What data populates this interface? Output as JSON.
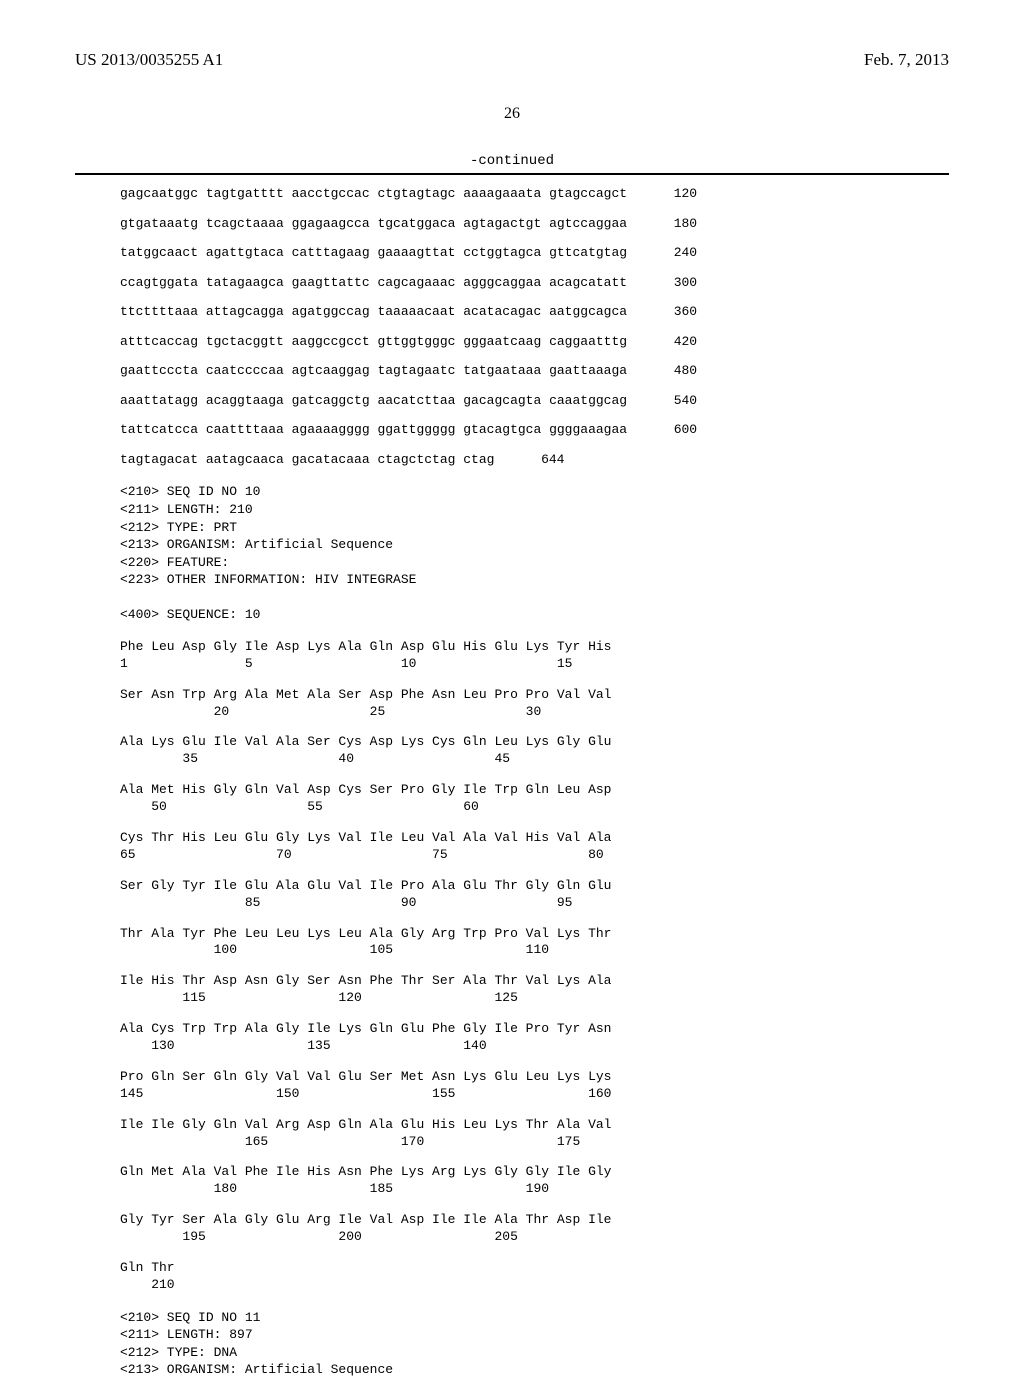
{
  "header": {
    "pub_number": "US 2013/0035255 A1",
    "pub_date": "Feb. 7, 2013"
  },
  "page_number": "26",
  "continued_label": "-continued",
  "dna_lines": [
    {
      "seq": "gagcaatggc tagtgatttt aacctgccac ctgtagtagc aaaagaaata gtagccagct",
      "num": "120"
    },
    {
      "seq": "gtgataaatg tcagctaaaa ggagaagcca tgcatggaca agtagactgt agtccaggaa",
      "num": "180"
    },
    {
      "seq": "tatggcaact agattgtaca catttagaag gaaaagttat cctggtagca gttcatgtag",
      "num": "240"
    },
    {
      "seq": "ccagtggata tatagaagca gaagttattc cagcagaaac agggcaggaa acagcatatt",
      "num": "300"
    },
    {
      "seq": "ttcttttaaa attagcagga agatggccag taaaaacaat acatacagac aatggcagca",
      "num": "360"
    },
    {
      "seq": "atttcaccag tgctacggtt aaggccgcct gttggtgggc gggaatcaag caggaatttg",
      "num": "420"
    },
    {
      "seq": "gaattcccta caatccccaa agtcaaggag tagtagaatc tatgaataaa gaattaaaga",
      "num": "480"
    },
    {
      "seq": "aaattatagg acaggtaaga gatcaggctg aacatcttaa gacagcagta caaatggcag",
      "num": "540"
    },
    {
      "seq": "tattcatcca caattttaaa agaaaagggg ggattggggg gtacagtgca ggggaaagaa",
      "num": "600"
    },
    {
      "seq": "tagtagacat aatagcaaca gacatacaaa ctagctctag ctag",
      "num": "644"
    }
  ],
  "seq10_meta": [
    "<210> SEQ ID NO 10",
    "<211> LENGTH: 210",
    "<212> TYPE: PRT",
    "<213> ORGANISM: Artificial Sequence",
    "<220> FEATURE:",
    "<223> OTHER INFORMATION: HIV INTEGRASE",
    "",
    "<400> SEQUENCE: 10"
  ],
  "protein_rows": [
    {
      "aa": "Phe Leu Asp Gly Ile Asp Lys Ala Gln Asp Glu His Glu Lys Tyr His",
      "nums": "1               5                   10                  15"
    },
    {
      "aa": "Ser Asn Trp Arg Ala Met Ala Ser Asp Phe Asn Leu Pro Pro Val Val",
      "nums": "            20                  25                  30"
    },
    {
      "aa": "Ala Lys Glu Ile Val Ala Ser Cys Asp Lys Cys Gln Leu Lys Gly Glu",
      "nums": "        35                  40                  45"
    },
    {
      "aa": "Ala Met His Gly Gln Val Asp Cys Ser Pro Gly Ile Trp Gln Leu Asp",
      "nums": "    50                  55                  60"
    },
    {
      "aa": "Cys Thr His Leu Glu Gly Lys Val Ile Leu Val Ala Val His Val Ala",
      "nums": "65                  70                  75                  80"
    },
    {
      "aa": "Ser Gly Tyr Ile Glu Ala Glu Val Ile Pro Ala Glu Thr Gly Gln Glu",
      "nums": "                85                  90                  95"
    },
    {
      "aa": "Thr Ala Tyr Phe Leu Leu Lys Leu Ala Gly Arg Trp Pro Val Lys Thr",
      "nums": "            100                 105                 110"
    },
    {
      "aa": "Ile His Thr Asp Asn Gly Ser Asn Phe Thr Ser Ala Thr Val Lys Ala",
      "nums": "        115                 120                 125"
    },
    {
      "aa": "Ala Cys Trp Trp Ala Gly Ile Lys Gln Glu Phe Gly Ile Pro Tyr Asn",
      "nums": "    130                 135                 140"
    },
    {
      "aa": "Pro Gln Ser Gln Gly Val Val Glu Ser Met Asn Lys Glu Leu Lys Lys",
      "nums": "145                 150                 155                 160"
    },
    {
      "aa": "Ile Ile Gly Gln Val Arg Asp Gln Ala Glu His Leu Lys Thr Ala Val",
      "nums": "                165                 170                 175"
    },
    {
      "aa": "Gln Met Ala Val Phe Ile His Asn Phe Lys Arg Lys Gly Gly Ile Gly",
      "nums": "            180                 185                 190"
    },
    {
      "aa": "Gly Tyr Ser Ala Gly Glu Arg Ile Val Asp Ile Ile Ala Thr Asp Ile",
      "nums": "        195                 200                 205"
    },
    {
      "aa": "Gln Thr",
      "nums": "    210"
    }
  ],
  "seq11_meta": [
    "<210> SEQ ID NO 11",
    "<211> LENGTH: 897",
    "<212> TYPE: DNA",
    "<213> ORGANISM: Artificial Sequence"
  ]
}
